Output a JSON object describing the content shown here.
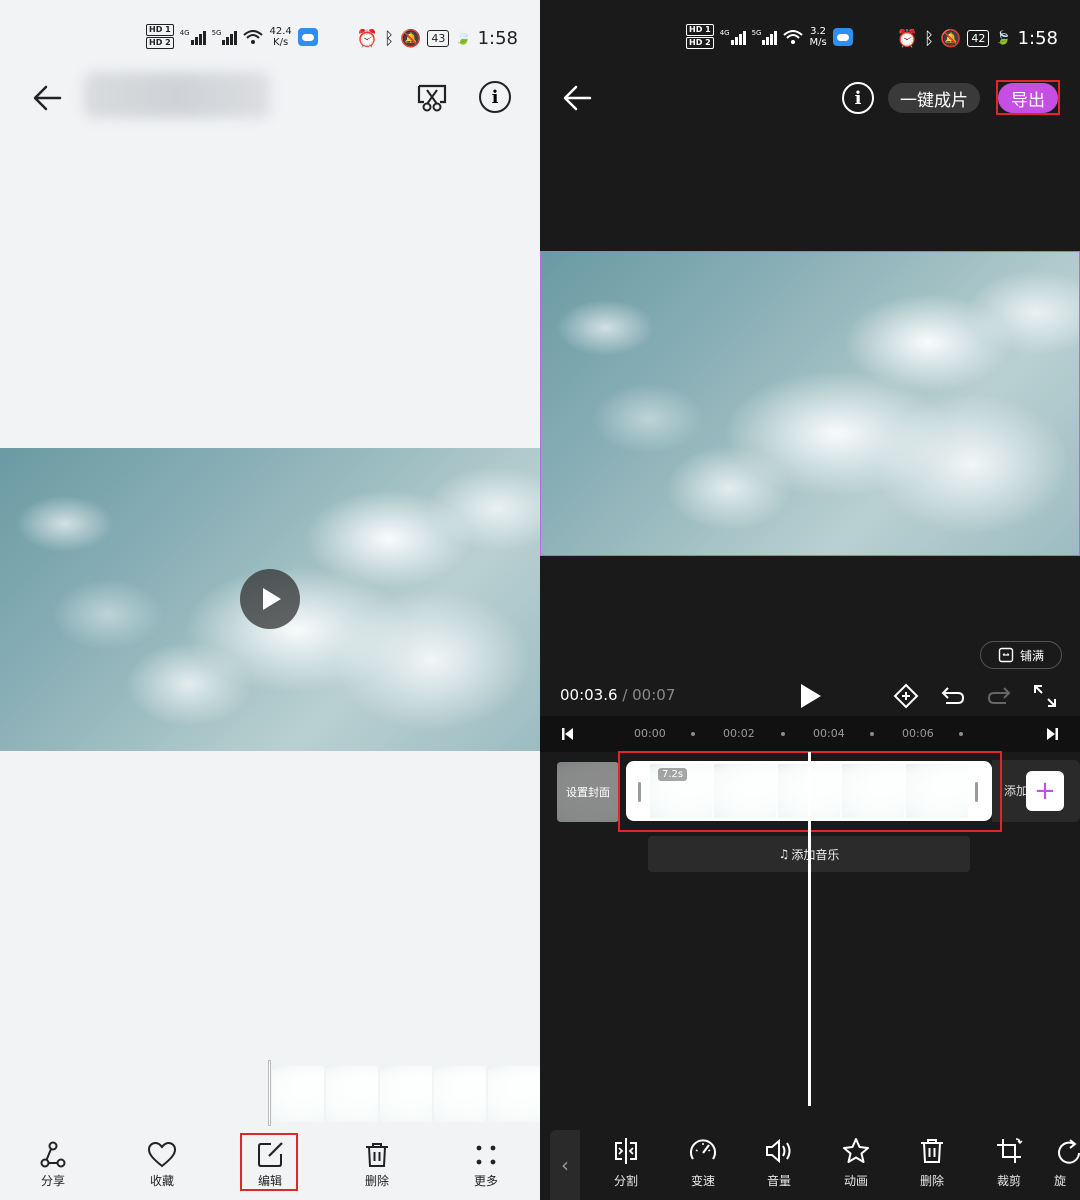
{
  "left_status": {
    "net_speed": "42.4",
    "net_unit": "K/s",
    "battery": "43",
    "time": "1:58"
  },
  "right_status": {
    "net_speed": "3.2",
    "net_unit": "M/s",
    "battery": "42",
    "time": "1:58"
  },
  "left_toolbar": [
    {
      "label": "分享",
      "icon": "share-icon"
    },
    {
      "label": "收藏",
      "icon": "heart-icon"
    },
    {
      "label": "编辑",
      "icon": "edit-icon"
    },
    {
      "label": "删除",
      "icon": "trash-icon"
    },
    {
      "label": "更多",
      "icon": "more-icon"
    }
  ],
  "editor": {
    "one_click_label": "一键成片",
    "export_label": "导出",
    "fill_label": "铺满",
    "current_time": "00:03.6",
    "separator": " / ",
    "total_time": "00:07",
    "ruler_ticks": [
      "00:00",
      "00:02",
      "00:04",
      "00:06"
    ],
    "cover_label": "设置封面",
    "clip_duration": "7.2s",
    "add_label": "添加",
    "add_music_label": "添加音乐",
    "accent_color": "#c44fe2"
  },
  "editor_tools": [
    {
      "label": "分割",
      "icon": "split-icon"
    },
    {
      "label": "变速",
      "icon": "speed-icon"
    },
    {
      "label": "音量",
      "icon": "volume-icon"
    },
    {
      "label": "动画",
      "icon": "animation-star-icon"
    },
    {
      "label": "删除",
      "icon": "trash-icon"
    },
    {
      "label": "裁剪",
      "icon": "crop-icon"
    },
    {
      "label": "旋",
      "icon": "rotate-icon"
    }
  ]
}
